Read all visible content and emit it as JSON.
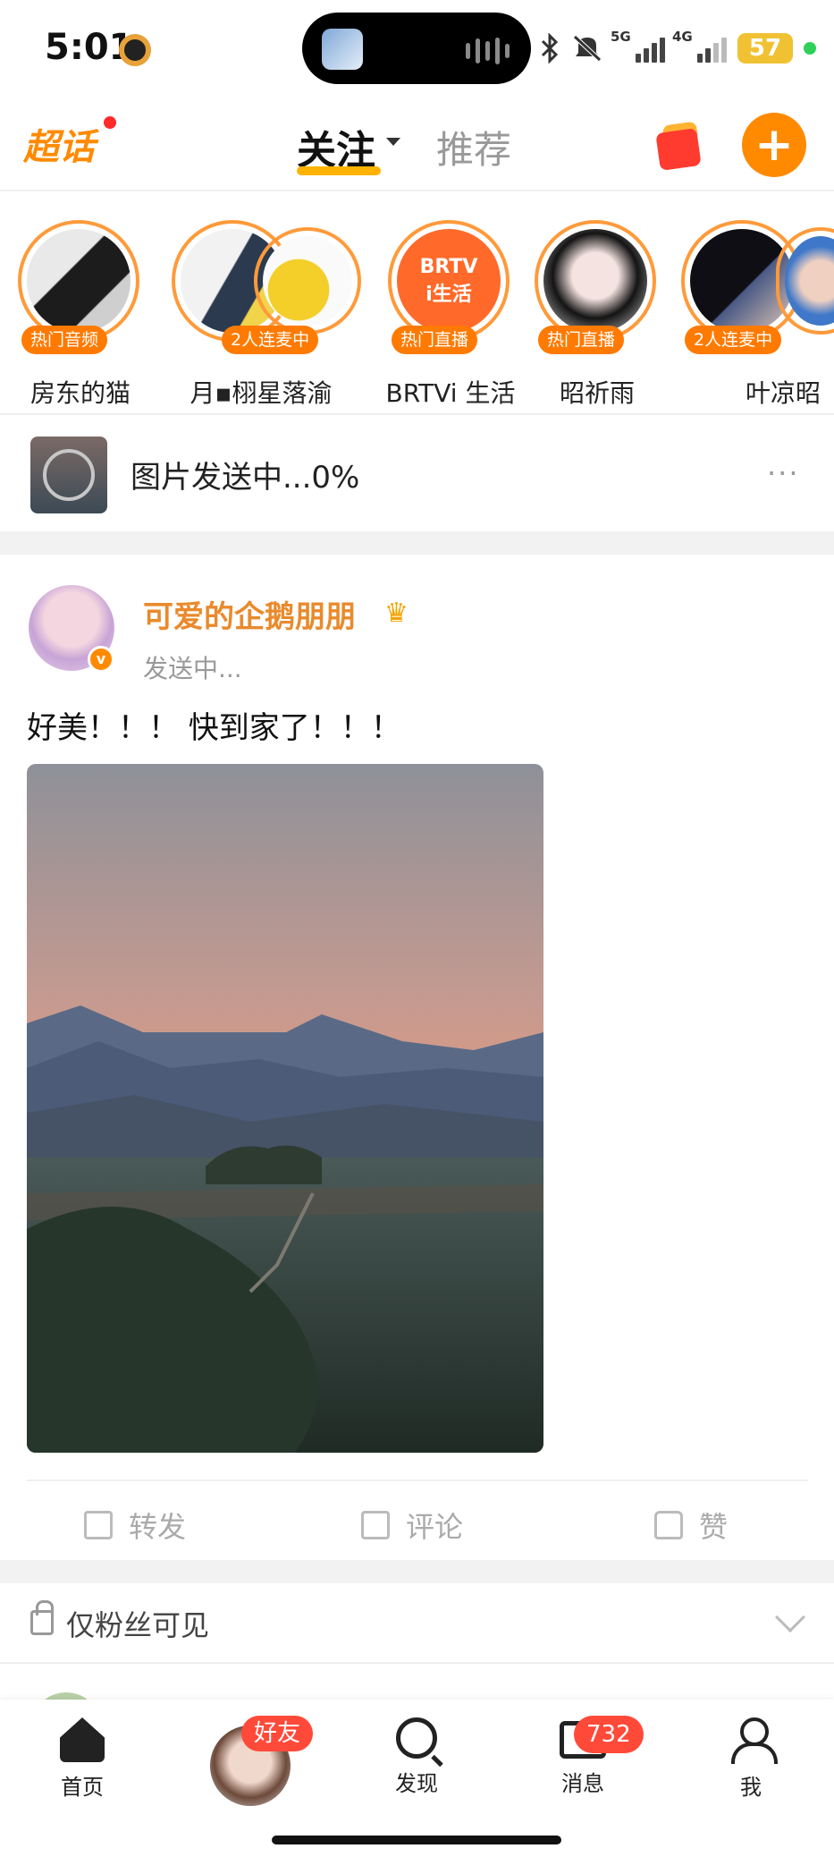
{
  "status_bar": {
    "time": "5:01",
    "net1": "5G",
    "net2": "4G",
    "battery": "57"
  },
  "header": {
    "logo": "超话",
    "tab_follow": "关注",
    "tab_recommend": "推荐",
    "post_button": "+"
  },
  "stories": [
    {
      "name": "房东的猫",
      "tag": "热门音频"
    },
    {
      "name": "月▪栩星落渝",
      "tag": "2人连麦中"
    },
    {
      "name": "BRTVi 生活",
      "tag": "热门直播",
      "logo_line1": "BRTV",
      "logo_line2": "i生活"
    },
    {
      "name": "昭祈雨",
      "tag": "热门直播"
    },
    {
      "name": "叶凉昭",
      "tag": "2人连麦中"
    }
  ],
  "upload": {
    "text": "图片发送中...0%",
    "more": "···"
  },
  "post": {
    "author": "可爱的企鹅朋朋",
    "status": "发送中...",
    "text": "好美！！！ 快到家了！！！",
    "actions": {
      "repost": "转发",
      "comment": "评论",
      "like": "赞"
    }
  },
  "visibility": {
    "label": "仅粉丝可见"
  },
  "tabbar": {
    "home": "首页",
    "friends_badge": "好友",
    "discover": "发现",
    "messages": "消息",
    "messages_count": "732",
    "me": "我"
  },
  "colors": {
    "accent": "#ff8a00",
    "author": "#e98a2c",
    "badge": "#ff4a3a"
  }
}
